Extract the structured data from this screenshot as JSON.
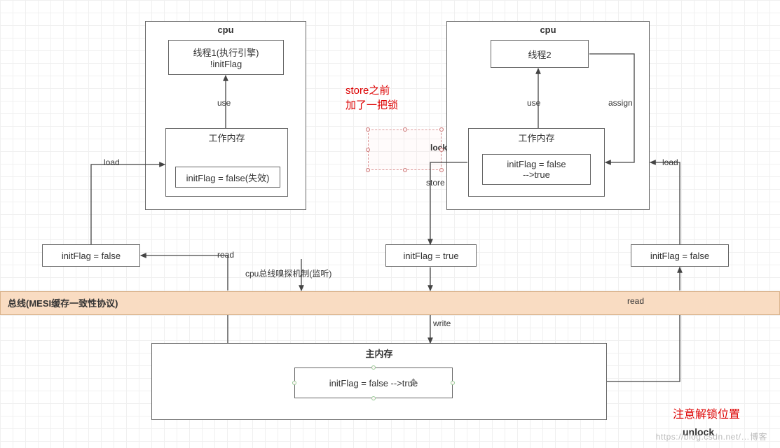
{
  "cpu1": {
    "title": "cpu",
    "thread_box": "线程1(执行引擎)\n!initFlag",
    "work_mem_label": "工作内存",
    "cache_value": "initFlag = false(失效)",
    "use_label": "use",
    "load_label": "load",
    "read_label": "read",
    "sniff_label": "cpu总线嗅探机制(监听)",
    "local_var": "initFlag = false"
  },
  "cpu2": {
    "title": "cpu",
    "thread_box": "线程2",
    "work_mem_label": "工作内存",
    "cache_value": "initFlag = false\n-->true",
    "use_label": "use",
    "assign_label": "assign",
    "load_label": "load",
    "store_label": "store",
    "lock_label": "lock",
    "write_label": "write",
    "read_label": "read",
    "local_store": "initFlag = true",
    "local_load": "initFlag = false"
  },
  "annotations": {
    "before_store": "store之前\n加了一把锁",
    "unlock_note": "注意解锁位置",
    "unlock_label": "unlock"
  },
  "bus": {
    "label": "总线(MESI缓存一致性协议)"
  },
  "main_memory": {
    "title": "主内存",
    "value": "initFlag = false -->true"
  },
  "watermark": "https://blog.csdn.net/…博客"
}
